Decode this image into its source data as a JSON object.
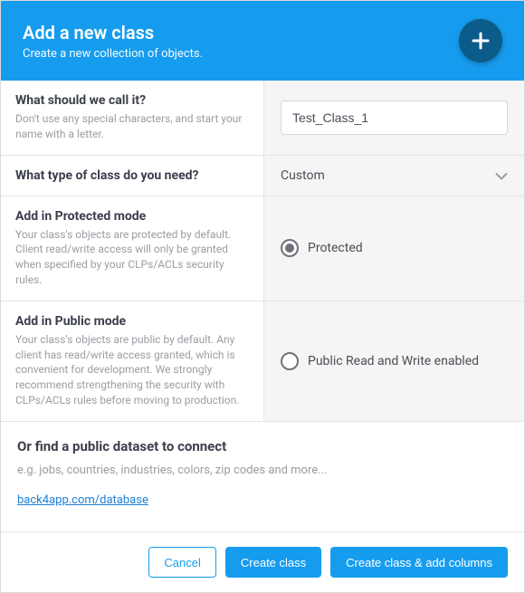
{
  "header": {
    "title": "Add a new class",
    "subtitle": "Create a new collection of objects."
  },
  "name_section": {
    "question": "What should we call it?",
    "help": "Don't use any special characters, and start your name with a letter.",
    "value": "Test_Class_1"
  },
  "type_section": {
    "question": "What type of class do you need?",
    "selected": "Custom"
  },
  "mode": {
    "protected": {
      "title": "Add in Protected mode",
      "help": "Your class's objects are protected by default. Client read/write access will only be granted when specified by your CLPs/ACLs security rules.",
      "option": "Protected"
    },
    "public": {
      "title": "Add in Public mode",
      "help": "Your class's objects are public by default. Any client has read/write access granted, which is convenient for development. We strongly recommend strengthening the security with CLPs/ACLs rules before moving to production.",
      "option": "Public Read and Write enabled"
    }
  },
  "dataset": {
    "title": "Or find a public dataset to connect",
    "example": "e.g. jobs, countries, industries, colors, zip codes and more...",
    "link": "back4app.com/database"
  },
  "footer": {
    "cancel": "Cancel",
    "create": "Create class",
    "create_add": "Create class & add columns"
  }
}
